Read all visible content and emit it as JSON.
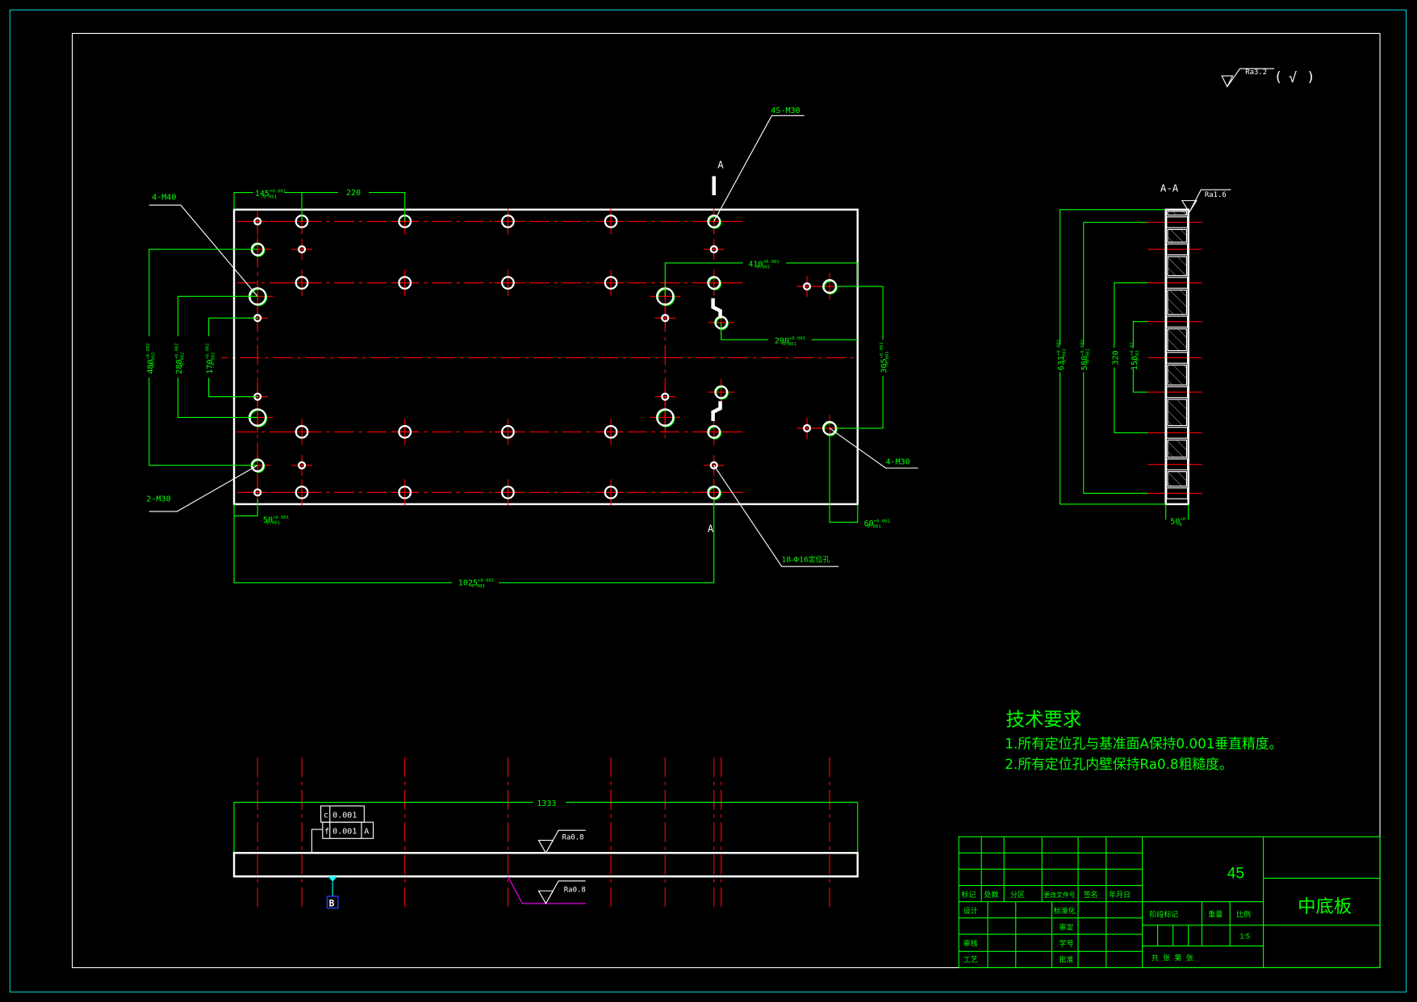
{
  "colors": {
    "background": "#000000",
    "outline": "#ffffff",
    "dimension": "#00ff00",
    "centerline": "#ff0000",
    "sheet_border": "#00c8c8",
    "datum": "#00ffff",
    "leader_bottom": "#ff00ff"
  },
  "roughness_default": {
    "value": "Ra3.2",
    "open": "(",
    "check": "√",
    "close": ")"
  },
  "plan_view": {
    "section_mark_top": "A",
    "section_mark_bottom": "A",
    "callouts": {
      "m40": "4-M40",
      "m30_left": "2-M30",
      "m30_right": "4-M30",
      "m30_top": "4S-M30",
      "dowel": "18-Φ16定位孔"
    },
    "dims": {
      "d145": {
        "value": "145",
        "upper": "+0.001",
        "lower": "-0.001"
      },
      "d220": {
        "value": "220"
      },
      "d480": {
        "value": "480",
        "upper": "+0.002",
        "lower": "-0.002"
      },
      "d280": {
        "value": "280",
        "upper": "+0.002",
        "lower": "-0.002"
      },
      "d170": {
        "value": "170",
        "upper": "+0.002",
        "lower": "-0.002"
      },
      "d50": {
        "value": "50",
        "upper": "+0.001",
        "lower": "-0.001"
      },
      "d1025": {
        "value": "1025",
        "upper": "+0.001",
        "lower": "-0.001"
      },
      "d410": {
        "value": "410",
        "upper": "+0.001",
        "lower": "-0.001"
      },
      "d290": {
        "value": "290",
        "upper": "+0.001",
        "lower": "-0.001"
      },
      "d305": {
        "value": "305",
        "upper": "+0.001",
        "lower": "-0.001"
      },
      "d60": {
        "value": "60",
        "upper": "+0.001",
        "lower": "-0.001"
      }
    }
  },
  "section_view": {
    "title": "A-A",
    "roughness": "Ra1.6",
    "dims": {
      "d631": {
        "value": "631",
        "upper": "+0.002",
        "lower": "-0.002"
      },
      "d580": {
        "value": "580",
        "upper": "+0.002",
        "lower": "-0.002"
      },
      "d320": {
        "value": "320"
      },
      "d150": {
        "value": "150",
        "upper": "+0.02",
        "lower": "-0.02"
      },
      "d50": {
        "value": "50",
        "upper": "+0",
        "lower": "-0"
      }
    }
  },
  "front_view": {
    "length": "1333",
    "tolerance_1": {
      "symbol": "c",
      "value": "0.001"
    },
    "tolerance_2": {
      "symbol": "f",
      "value": "0.001",
      "datum": "A"
    },
    "roughness_top": "Ra0.8",
    "roughness_bottom": "Ra0.8",
    "datum": "B"
  },
  "tech_requirements": {
    "title": "技术要求",
    "items": [
      "1.所有定位孔与基准面A保持0.001垂直精度。",
      "2.所有定位孔内壁保持Ra0.8粗糙度。"
    ]
  },
  "title_block": {
    "material": "45",
    "part_name": "中底板",
    "headers": [
      "标记",
      "处数",
      "分区",
      "更改文件号",
      "签名",
      "年月日"
    ],
    "design": "设计",
    "standardization": "标准化",
    "approval_1": "审定",
    "review": "审核",
    "student_no": "学号",
    "process": "工艺",
    "approve": "批准",
    "stage_mark": "阶段标记",
    "weight": "重量",
    "scale_label": "比例",
    "scale": "1:5",
    "sheets": "共  张  第  张"
  }
}
